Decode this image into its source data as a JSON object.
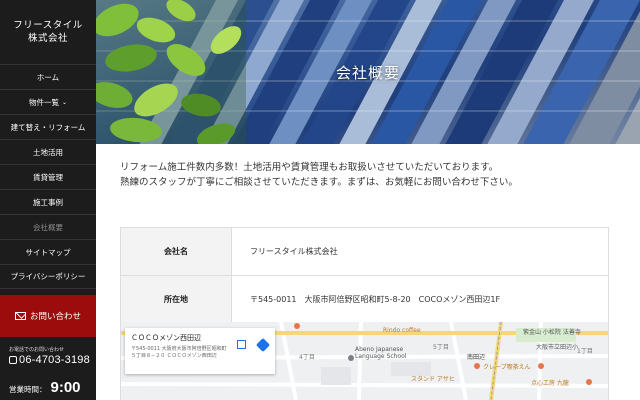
{
  "sidebar": {
    "logo_line1": "フリースタイル",
    "logo_line2": "株式会社",
    "nav": [
      {
        "label": "ホーム"
      },
      {
        "label": "物件一覧"
      },
      {
        "label": "建て替え・リフォーム"
      },
      {
        "label": "土地活用"
      },
      {
        "label": "賃貸管理"
      },
      {
        "label": "施工事例"
      },
      {
        "label": "会社概要"
      },
      {
        "label": "サイトマップ"
      },
      {
        "label": "プライバシーポリシー"
      }
    ],
    "contact_label": "お問い合わせ",
    "phone_caption": "お電話でのお問い合わせ",
    "phone_number": "06-4703-3198",
    "hours_label": "営業時間：",
    "hours_start": "9:00"
  },
  "hero": {
    "title": "会社概要"
  },
  "intro": {
    "line1": "リフォーム施工件数内多数！土地活用や賃貸管理もお取扱いさせていただいております。",
    "line2": "熟練のスタッフが丁寧にご相談させていただきます。まずは、お気軽にお問い合わせ下さい。"
  },
  "company_table": [
    {
      "label": "会社名",
      "value": "フリースタイル株式会社"
    },
    {
      "label": "所在地",
      "value": "〒545-0011　大阪市阿倍野区昭和町5-8-20　COCOメゾン西田辺1F"
    }
  ],
  "map": {
    "card_name": "ＣＯＣＯメゾン西田辺",
    "card_address": "〒545-0011 大阪府大阪市阿倍野区昭和町５丁目８−２０ ＣＯＣＯメゾン西田辺",
    "labels": [
      {
        "text": "Rindo coffee",
        "color": "#c0781e"
      },
      {
        "text": "紫金山 小松院 法善寺",
        "color": "#555555"
      },
      {
        "text": "大阪市立田辺小",
        "color": "#555555"
      },
      {
        "text": "Abeno Japanese",
        "color": "#555555"
      },
      {
        "text": "Language School",
        "color": "#555555"
      },
      {
        "text": "南田辺",
        "color": "#333333"
      },
      {
        "text": "クレープ喫茶えん",
        "color": "#c0781e"
      },
      {
        "text": "スタンド アサヒ",
        "color": "#c0781e"
      },
      {
        "text": "点心工房 九龍",
        "color": "#c0781e"
      },
      {
        "text": "4丁目",
        "color": "#777777"
      },
      {
        "text": "5丁目",
        "color": "#777777"
      },
      {
        "text": "1丁目",
        "color": "#777777"
      }
    ]
  },
  "colors": {
    "sidebar_bg": "#1c1c1c",
    "contact_bg": "#9c0c0c",
    "table_head_bg": "#f3f3f3"
  }
}
